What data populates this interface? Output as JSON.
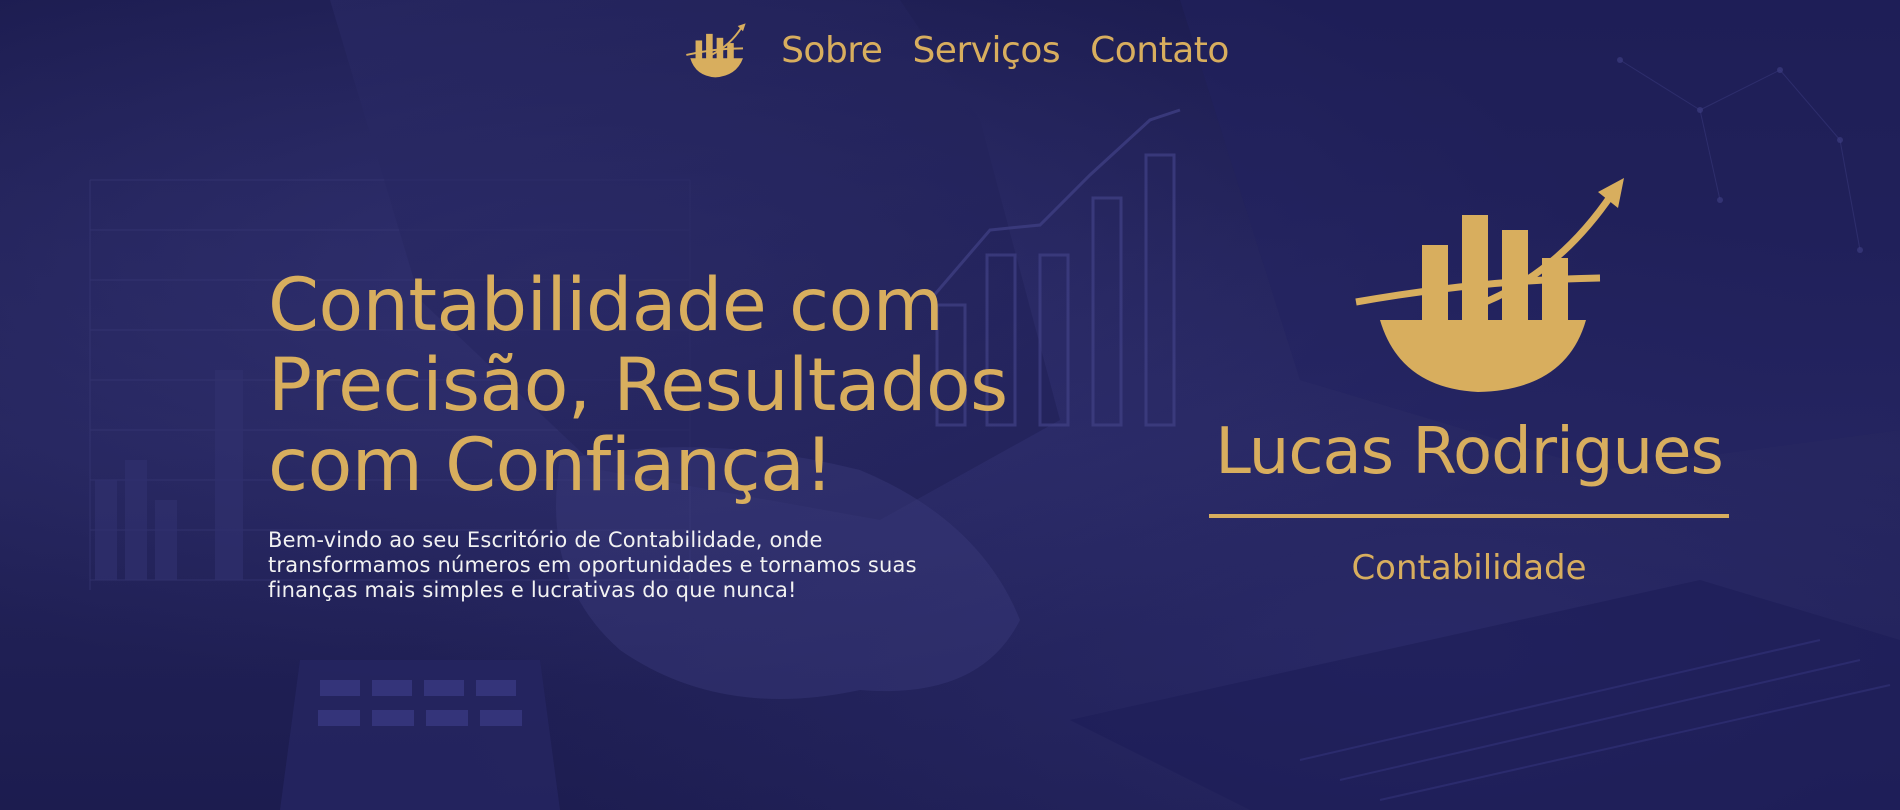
{
  "nav": {
    "items": [
      {
        "label": "Sobre"
      },
      {
        "label": "Serviços"
      },
      {
        "label": "Contato"
      }
    ]
  },
  "hero": {
    "headline_lines": [
      "Contabilidade com",
      "Precisão, Resultados",
      "com Confiança!"
    ],
    "subtitle_lines": [
      "Bem-vindo ao seu Escritório de Contabilidade, onde",
      "transformamos números em oportunidades e tornamos suas",
      "finanças mais simples e lucrativas do que nunca!"
    ]
  },
  "brand": {
    "name": "Lucas Rodrigues",
    "tagline": "Contabilidade"
  },
  "colors": {
    "accent_gold": "#d8ae5e",
    "background_navy": "#1b1b4e",
    "text_light": "#f2f2f2"
  },
  "icons": {
    "logo": "growth-chart-logo-icon"
  }
}
